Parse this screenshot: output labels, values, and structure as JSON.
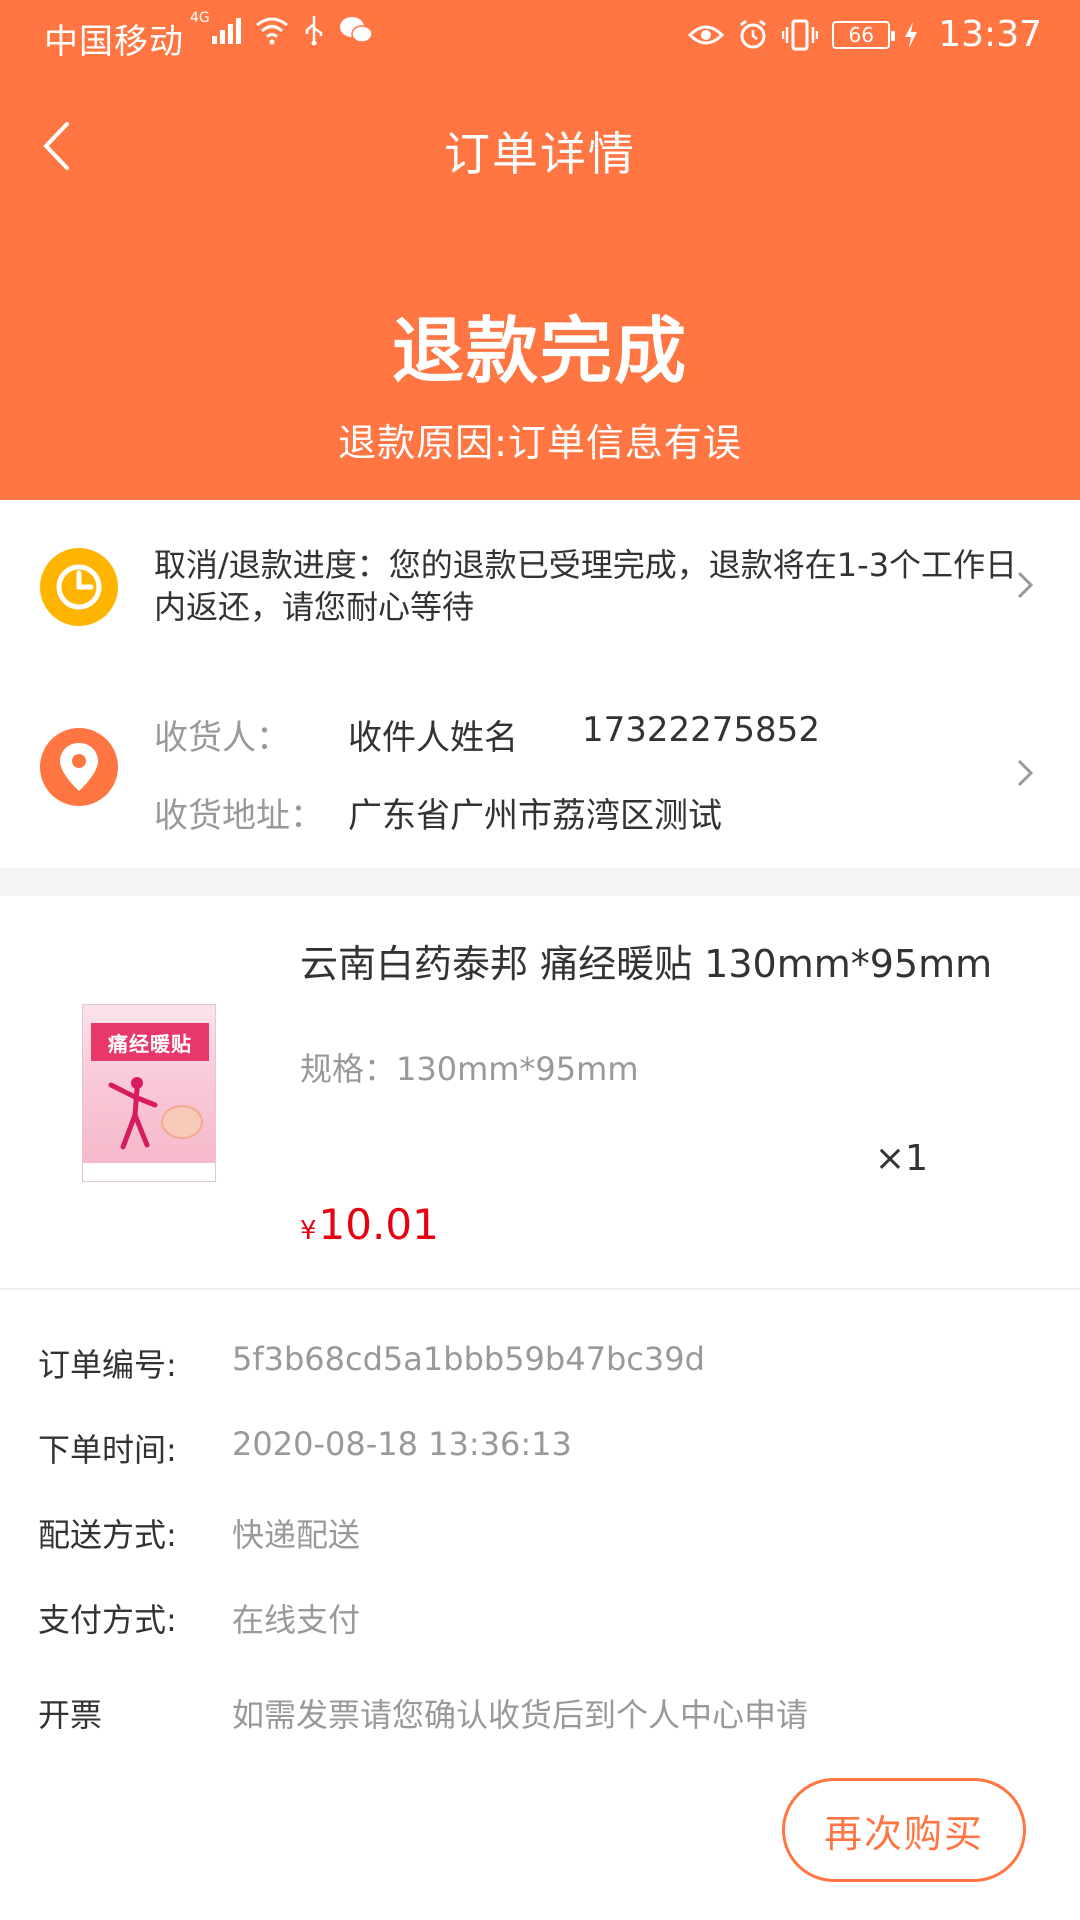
{
  "status_bar": {
    "carrier": "中国移动",
    "network": "4G",
    "battery": "66",
    "time": "13:37"
  },
  "nav": {
    "title": "订单详情"
  },
  "order_status": {
    "title": "退款完成",
    "reason": "退款原因:订单信息有误"
  },
  "progress": {
    "text": "取消/退款进度：您的退款已受理完成，退款将在1-3个工作日内返还，请您耐心等待"
  },
  "address": {
    "receiver_label": "收货人：",
    "receiver_name": "收件人姓名",
    "receiver_phone": "17322275852",
    "address_label": "收货地址：",
    "address": "广东省广州市荔湾区测试"
  },
  "product": {
    "name": "云南白药泰邦 痛经暖贴 130mm*95mm",
    "spec": "规格：130mm*95mm",
    "quantity": "×1",
    "currency": "¥",
    "price": "10.01",
    "image_text": "痛经暖贴"
  },
  "info": [
    {
      "label": "订单编号:",
      "value": "5f3b68cd5a1bbb59b47bc39d"
    },
    {
      "label": "下单时间:",
      "value": "2020-08-18 13:36:13"
    },
    {
      "label": "配送方式:",
      "value": "快递配送"
    },
    {
      "label": "支付方式:",
      "value": "在线支付"
    },
    {
      "label": "开票",
      "value": "如需发票请您确认收货后到个人中心申请"
    }
  ],
  "actions": {
    "rebuy": "再次购买"
  },
  "colors": {
    "brand": "#FF7643",
    "price": "#E60012",
    "progress_icon": "#FFB400",
    "location_icon": "#FF7643"
  }
}
